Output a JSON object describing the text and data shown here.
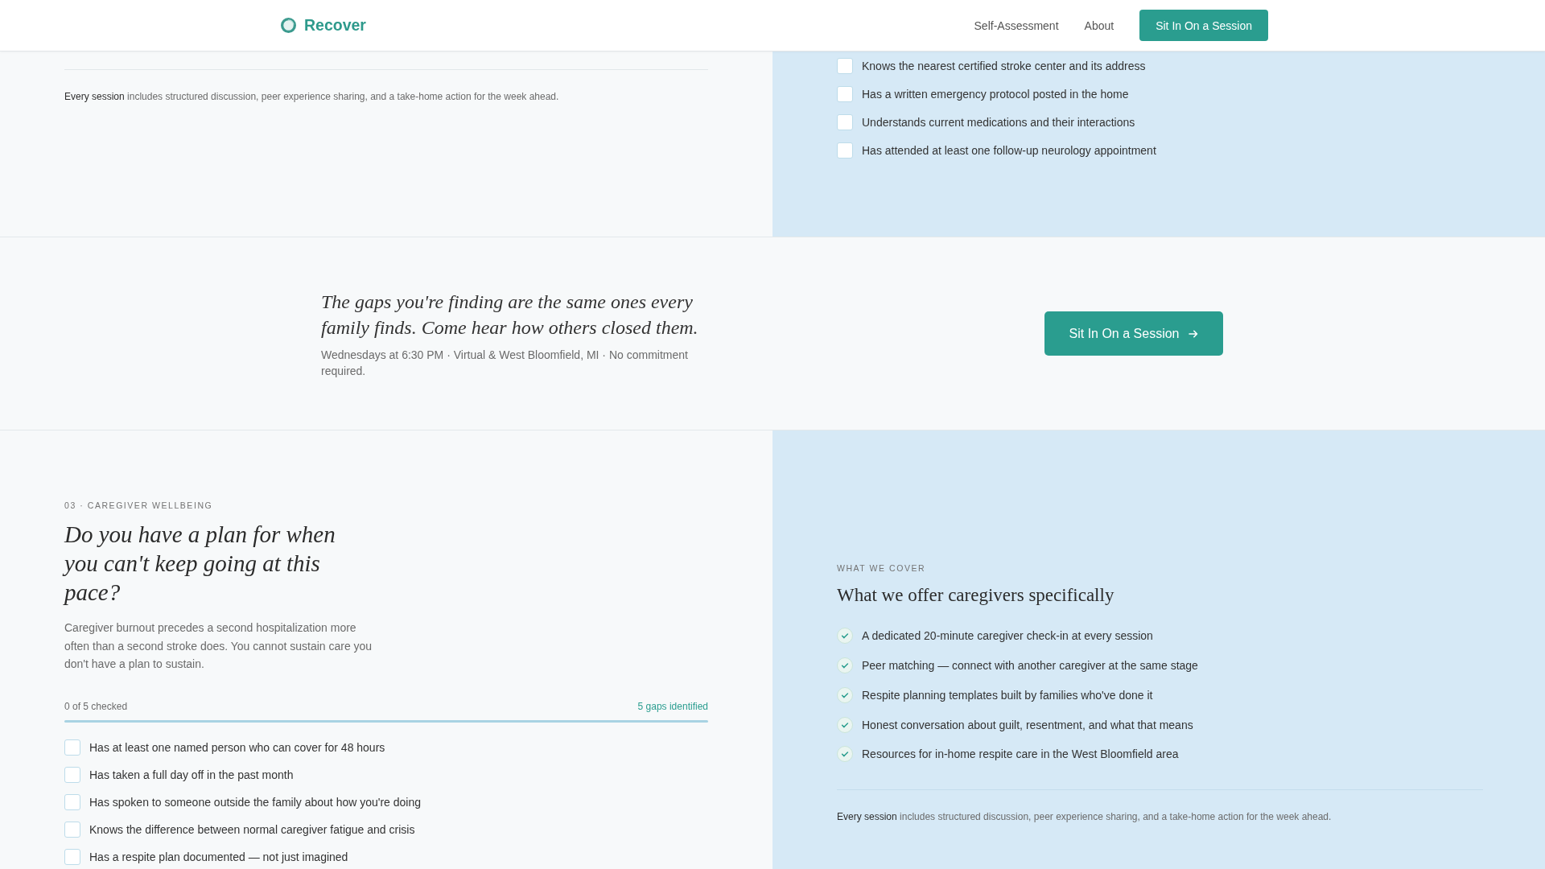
{
  "header": {
    "brand": "Recover",
    "nav": [
      {
        "label": "Self-Assessment"
      },
      {
        "label": "About"
      }
    ],
    "button": "Sit In On a Session"
  },
  "top_section": {
    "note": "**Every session** includes structured discussion, peer experience sharing, and a take-home action for the week ahead.",
    "checklist": [
      {
        "label": "Knows the nearest certified stroke center and its address",
        "checked": false
      },
      {
        "label": "Has a written emergency protocol posted in the home",
        "checked": false
      },
      {
        "label": "Understands current medications and their interactions",
        "checked": false
      },
      {
        "label": "Has attended at least one follow-up neurology appointment",
        "checked": false
      }
    ]
  },
  "cta_band": {
    "quote": "The gaps you're finding are the same ones every family finds. Come hear how others closed them.",
    "details": "Wednesdays at 6:30 PM · Virtual & West Bloomfield, MI · No commitment required.",
    "button": "Sit In On a Session"
  },
  "caregiver_section": {
    "eyebrow": "03 · CAREGIVER WELLBEING",
    "heading": "Do you have a plan for when you can't keep going at this pace?",
    "intro": "Caregiver burnout precedes a second hospitalization more often than a second stroke does. You cannot sustain care you don't have a plan to sustain.",
    "progress": {
      "count": "0 of 5 checked",
      "gaps": "5 gaps identified",
      "level": 0
    },
    "checklist": [
      {
        "label": "Has at least one named person who can cover for 48 hours",
        "checked": false
      },
      {
        "label": "Has taken a full day off in the past month",
        "checked": false
      },
      {
        "label": "Has spoken to someone outside the family about how you're doing",
        "checked": false
      },
      {
        "label": "Knows the difference between normal caregiver fatigue and crisis",
        "checked": false
      },
      {
        "label": "Has a respite plan documented — not just imagined",
        "checked": false
      }
    ]
  },
  "what_we_cover": {
    "eyebrow": "WHAT WE COVER",
    "heading": "What we offer caregivers specifically",
    "items": [
      "A dedicated 20-minute caregiver check-in at every session",
      "Peer matching — connect with another caregiver at the same stage",
      "Respite planning templates built by families who've done it",
      "Honest conversation about guilt, resentment, and what that means",
      "Resources for in-home respite care in the West Bloomfield area"
    ],
    "note": "**Every session** includes structured discussion, peer experience sharing, and a take-home action for the week ahead."
  }
}
